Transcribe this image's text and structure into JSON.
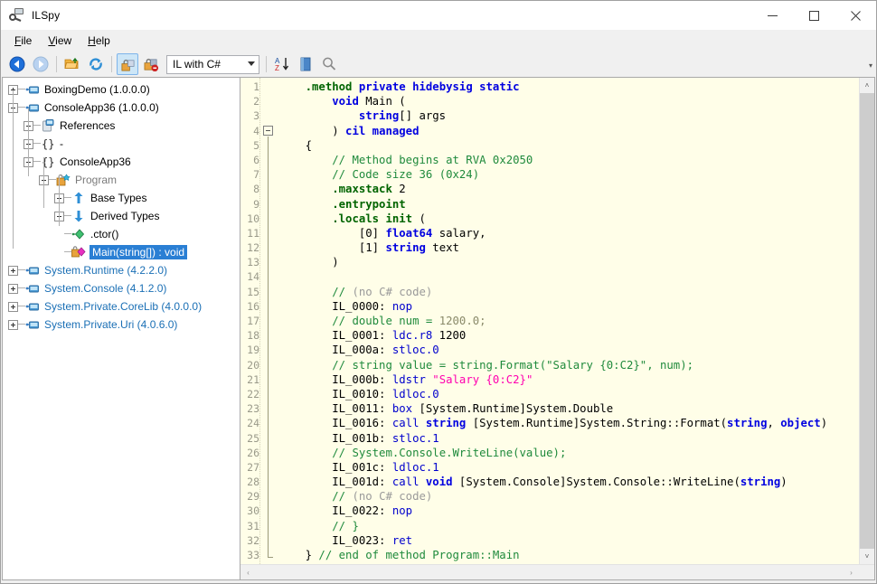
{
  "window": {
    "title": "ILSpy",
    "icon": "ilspy-app-icon",
    "minimize_label": "—",
    "maximize_label": "□",
    "close_label": "✕"
  },
  "menubar": {
    "items": [
      {
        "accel": "F",
        "rest": "ile",
        "name": "file"
      },
      {
        "accel": "V",
        "rest": "iew",
        "name": "view"
      },
      {
        "accel": "H",
        "rest": "elp",
        "name": "help"
      }
    ]
  },
  "toolbar": {
    "back_label": "Back",
    "forward_label": "Forward",
    "open_label": "Open",
    "refresh_label": "Refresh",
    "language_value": "IL with C#",
    "sort_label": "Sort assembly list",
    "collapse_label": "Collapse",
    "search_label": "Search",
    "overflow_label": "▾"
  },
  "tree": {
    "nodes": [
      {
        "depth": 0,
        "expander": "plus",
        "icon": "assembly-icon",
        "label": "BoxingDemo (1.0.0.0)",
        "style": "normal",
        "selected": false
      },
      {
        "depth": 0,
        "expander": "minus",
        "icon": "assembly-icon",
        "label": "ConsoleApp36 (1.0.0.0)",
        "style": "normal",
        "selected": false
      },
      {
        "depth": 1,
        "expander": "plus",
        "icon": "references-icon",
        "label": "References",
        "style": "normal",
        "selected": false
      },
      {
        "depth": 1,
        "expander": "plus",
        "icon": "namespace-icon",
        "label": "-",
        "style": "normal",
        "selected": false
      },
      {
        "depth": 1,
        "expander": "minus",
        "icon": "namespace-icon",
        "label": "ConsoleApp36",
        "style": "normal",
        "selected": false
      },
      {
        "depth": 2,
        "expander": "minus",
        "icon": "class-icon",
        "label": "Program",
        "style": "gray",
        "selected": false
      },
      {
        "depth": 3,
        "expander": "plus",
        "icon": "base-types-icon",
        "label": "Base Types",
        "style": "normal",
        "selected": false
      },
      {
        "depth": 3,
        "expander": "plus",
        "icon": "derived-types-icon",
        "label": "Derived Types",
        "style": "normal",
        "selected": false
      },
      {
        "depth": 3,
        "expander": "none",
        "icon": "constructor-icon",
        "label": ".ctor()",
        "style": "normal",
        "selected": false
      },
      {
        "depth": 3,
        "expander": "none",
        "icon": "method-icon",
        "label": "Main(string[]) : void",
        "style": "normal",
        "selected": true
      },
      {
        "depth": 0,
        "expander": "plus",
        "icon": "assembly-icon",
        "label": "System.Runtime (4.2.2.0)",
        "style": "link",
        "selected": false
      },
      {
        "depth": 0,
        "expander": "plus",
        "icon": "assembly-icon",
        "label": "System.Console (4.1.2.0)",
        "style": "link",
        "selected": false
      },
      {
        "depth": 0,
        "expander": "plus",
        "icon": "assembly-icon",
        "label": "System.Private.CoreLib (4.0.0.0)",
        "style": "link",
        "selected": false
      },
      {
        "depth": 0,
        "expander": "plus",
        "icon": "assembly-icon",
        "label": "System.Private.Uri (4.0.6.0)",
        "style": "link",
        "selected": false
      }
    ]
  },
  "code": {
    "first_line": 1,
    "last_line": 33,
    "fold_start_line": 4,
    "fold_end_line": 33,
    "lines": [
      {
        "n": 1,
        "tokens": [
          {
            "t": "    ",
            "c": ""
          },
          {
            "t": ".method ",
            "c": "dir"
          },
          {
            "t": "private hidebysig static",
            "c": "kw"
          }
        ]
      },
      {
        "n": 2,
        "tokens": [
          {
            "t": "        ",
            "c": ""
          },
          {
            "t": "void",
            "c": "kw"
          },
          {
            "t": " Main (",
            "c": ""
          }
        ]
      },
      {
        "n": 3,
        "tokens": [
          {
            "t": "            ",
            "c": ""
          },
          {
            "t": "string",
            "c": "kw"
          },
          {
            "t": "[] args",
            "c": ""
          }
        ]
      },
      {
        "n": 4,
        "tokens": [
          {
            "t": "        ) ",
            "c": ""
          },
          {
            "t": "cil managed",
            "c": "kw"
          }
        ]
      },
      {
        "n": 5,
        "tokens": [
          {
            "t": "    {",
            "c": ""
          }
        ]
      },
      {
        "n": 6,
        "tokens": [
          {
            "t": "        ",
            "c": ""
          },
          {
            "t": "// Method begins at RVA 0x2050",
            "c": "cmt"
          }
        ]
      },
      {
        "n": 7,
        "tokens": [
          {
            "t": "        ",
            "c": ""
          },
          {
            "t": "// Code size 36 (0x24)",
            "c": "cmt"
          }
        ]
      },
      {
        "n": 8,
        "tokens": [
          {
            "t": "        ",
            "c": ""
          },
          {
            "t": ".maxstack",
            "c": "dir"
          },
          {
            "t": " 2",
            "c": ""
          }
        ]
      },
      {
        "n": 9,
        "tokens": [
          {
            "t": "        ",
            "c": ""
          },
          {
            "t": ".entrypoint",
            "c": "dir"
          }
        ]
      },
      {
        "n": 10,
        "tokens": [
          {
            "t": "        ",
            "c": ""
          },
          {
            "t": ".locals init",
            "c": "dir"
          },
          {
            "t": " (",
            "c": ""
          }
        ]
      },
      {
        "n": 11,
        "tokens": [
          {
            "t": "            [0] ",
            "c": ""
          },
          {
            "t": "float64",
            "c": "kw"
          },
          {
            "t": " salary,",
            "c": ""
          }
        ]
      },
      {
        "n": 12,
        "tokens": [
          {
            "t": "            [1] ",
            "c": ""
          },
          {
            "t": "string",
            "c": "kw"
          },
          {
            "t": " text",
            "c": ""
          }
        ]
      },
      {
        "n": 13,
        "tokens": [
          {
            "t": "        )",
            "c": ""
          }
        ]
      },
      {
        "n": 14,
        "tokens": [
          {
            "t": "",
            "c": ""
          }
        ]
      },
      {
        "n": 15,
        "tokens": [
          {
            "t": "        ",
            "c": ""
          },
          {
            "t": "// ",
            "c": "cmt"
          },
          {
            "t": "(no C# code)",
            "c": "cmtg"
          }
        ]
      },
      {
        "n": 16,
        "tokens": [
          {
            "t": "        IL_0000: ",
            "c": ""
          },
          {
            "t": "nop",
            "c": "op"
          }
        ]
      },
      {
        "n": 17,
        "tokens": [
          {
            "t": "        ",
            "c": ""
          },
          {
            "t": "// double num = ",
            "c": "cmt"
          },
          {
            "t": "1200.0;",
            "c": "num"
          }
        ]
      },
      {
        "n": 18,
        "tokens": [
          {
            "t": "        IL_0001: ",
            "c": ""
          },
          {
            "t": "ldc.r8",
            "c": "op"
          },
          {
            "t": " 1200",
            "c": ""
          }
        ]
      },
      {
        "n": 19,
        "tokens": [
          {
            "t": "        IL_000a: ",
            "c": ""
          },
          {
            "t": "stloc.0",
            "c": "op"
          }
        ]
      },
      {
        "n": 20,
        "tokens": [
          {
            "t": "        ",
            "c": ""
          },
          {
            "t": "// string value = string.Format(\"Salary {0:C2}\", num);",
            "c": "cmt"
          }
        ]
      },
      {
        "n": 21,
        "tokens": [
          {
            "t": "        IL_000b: ",
            "c": ""
          },
          {
            "t": "ldstr",
            "c": "op"
          },
          {
            "t": " ",
            "c": ""
          },
          {
            "t": "\"Salary {0:C2}\"",
            "c": "str"
          }
        ]
      },
      {
        "n": 22,
        "tokens": [
          {
            "t": "        IL_0010: ",
            "c": ""
          },
          {
            "t": "ldloc.0",
            "c": "op"
          }
        ]
      },
      {
        "n": 23,
        "tokens": [
          {
            "t": "        IL_0011: ",
            "c": ""
          },
          {
            "t": "box",
            "c": "op"
          },
          {
            "t": " [System.Runtime]System.Double",
            "c": ""
          }
        ]
      },
      {
        "n": 24,
        "tokens": [
          {
            "t": "        IL_0016: ",
            "c": ""
          },
          {
            "t": "call",
            "c": "op"
          },
          {
            "t": " ",
            "c": ""
          },
          {
            "t": "string",
            "c": "kw"
          },
          {
            "t": " [System.Runtime]System.String::Format(",
            "c": ""
          },
          {
            "t": "string",
            "c": "kw"
          },
          {
            "t": ", ",
            "c": ""
          },
          {
            "t": "object",
            "c": "kw"
          },
          {
            "t": ")",
            "c": ""
          }
        ]
      },
      {
        "n": 25,
        "tokens": [
          {
            "t": "        IL_001b: ",
            "c": ""
          },
          {
            "t": "stloc.1",
            "c": "op"
          }
        ]
      },
      {
        "n": 26,
        "tokens": [
          {
            "t": "        ",
            "c": ""
          },
          {
            "t": "// System.Console.WriteLine(value);",
            "c": "cmt"
          }
        ]
      },
      {
        "n": 27,
        "tokens": [
          {
            "t": "        IL_001c: ",
            "c": ""
          },
          {
            "t": "ldloc.1",
            "c": "op"
          }
        ]
      },
      {
        "n": 28,
        "tokens": [
          {
            "t": "        IL_001d: ",
            "c": ""
          },
          {
            "t": "call",
            "c": "op"
          },
          {
            "t": " ",
            "c": ""
          },
          {
            "t": "void",
            "c": "kw"
          },
          {
            "t": " [System.Console]System.Console::WriteLine(",
            "c": ""
          },
          {
            "t": "string",
            "c": "kw"
          },
          {
            "t": ")",
            "c": ""
          }
        ]
      },
      {
        "n": 29,
        "tokens": [
          {
            "t": "        ",
            "c": ""
          },
          {
            "t": "// ",
            "c": "cmt"
          },
          {
            "t": "(no C# code)",
            "c": "cmtg"
          }
        ]
      },
      {
        "n": 30,
        "tokens": [
          {
            "t": "        IL_0022: ",
            "c": ""
          },
          {
            "t": "nop",
            "c": "op"
          }
        ]
      },
      {
        "n": 31,
        "tokens": [
          {
            "t": "        ",
            "c": ""
          },
          {
            "t": "// }",
            "c": "cmt"
          }
        ]
      },
      {
        "n": 32,
        "tokens": [
          {
            "t": "        IL_0023: ",
            "c": ""
          },
          {
            "t": "ret",
            "c": "op"
          }
        ]
      },
      {
        "n": 33,
        "tokens": [
          {
            "t": "    } ",
            "c": ""
          },
          {
            "t": "// end of method Program::Main",
            "c": "cmt"
          }
        ]
      }
    ]
  },
  "scrollbars": {
    "vertical_up": "˄",
    "vertical_down": "˅",
    "horizontal_left": "‹",
    "horizontal_right": "›"
  },
  "colors": {
    "selection": "#2a7fd4",
    "code_bg": "#fffee8",
    "link": "#1a6fb5",
    "keyword": "#0000e0",
    "directive": "#006400",
    "comment": "#1f8a3c",
    "string": "#ff00b0",
    "opcode": "#0000cd"
  }
}
